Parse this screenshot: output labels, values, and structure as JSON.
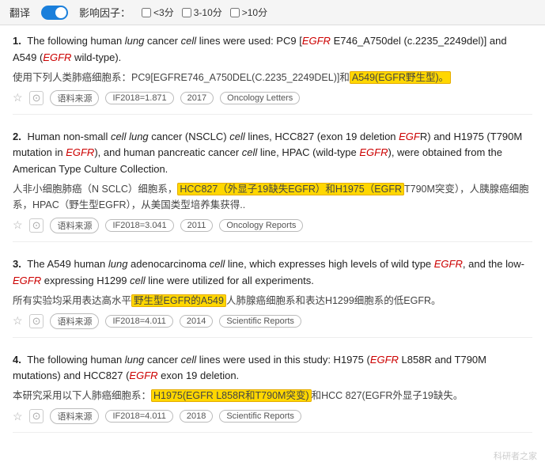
{
  "header": {
    "translate_label": "翻译",
    "toggle_state": true,
    "filter_label": "影响因子：",
    "filters": [
      {
        "label": "<3分",
        "checked": false
      },
      {
        "label": "3-10分",
        "checked": false
      },
      {
        "label": ">10分",
        "checked": false
      }
    ]
  },
  "results": [
    {
      "number": "1.",
      "en_text_parts": [
        {
          "text": "The following human ",
          "style": "normal"
        },
        {
          "text": "lung",
          "style": "italic"
        },
        {
          "text": " cancer ",
          "style": "normal"
        },
        {
          "text": "cell",
          "style": "italic"
        },
        {
          "text": " lines were used: PC9 [",
          "style": "normal"
        },
        {
          "text": "EGFR",
          "style": "italic-red"
        },
        {
          "text": " E746_A750del (c.2235_2249del)] and A549 (",
          "style": "normal"
        },
        {
          "text": "EGFR",
          "style": "italic-red"
        },
        {
          "text": " wild-type).",
          "style": "normal"
        }
      ],
      "cn_parts": [
        {
          "text": "使用下列人类肺癌细胞系：PC9[EGFRE746_A750DEL(C.2235_2249DEL)]和",
          "style": "normal"
        },
        {
          "text": "A549(EGFR野生型)。",
          "style": "highlight"
        }
      ],
      "meta": {
        "source": "语料来源",
        "if": "IF2018=1.871",
        "year": "2017",
        "journal": "Oncology Letters"
      }
    },
    {
      "number": "2.",
      "en_text_parts": [
        {
          "text": "Human non-small ",
          "style": "normal"
        },
        {
          "text": "cell lung",
          "style": "italic"
        },
        {
          "text": " cancer (NSCLC) ",
          "style": "normal"
        },
        {
          "text": "cell",
          "style": "italic"
        },
        {
          "text": " lines, HCC827 (exon 19 deletion ",
          "style": "normal"
        },
        {
          "text": "EGF",
          "style": "italic-red"
        },
        {
          "text": "R) and H1975 (T790M mutation in ",
          "style": "normal"
        },
        {
          "text": "EGFR",
          "style": "italic-red"
        },
        {
          "text": "), and human pancreatic cancer ",
          "style": "normal"
        },
        {
          "text": "cell",
          "style": "italic"
        },
        {
          "text": " line, HPAC (wild-type ",
          "style": "normal"
        },
        {
          "text": "EGFR",
          "style": "italic-red"
        },
        {
          "text": "), were obtained from the American Type Culture Collection.",
          "style": "normal"
        }
      ],
      "cn_parts": [
        {
          "text": "人非小细胞肺癌（N SCLC）细胞系，",
          "style": "normal"
        },
        {
          "text": "HCC827（外显子19缺失EGFR）和H1975（EGFR",
          "style": "highlight"
        },
        {
          "text": "T790M突变），人胰腺癌细胞系，HPAC（野生型EGFR），从美国类型培养集获得..",
          "style": "normal"
        }
      ],
      "meta": {
        "source": "语料来源",
        "if": "IF2018=3.041",
        "year": "2011",
        "journal": "Oncology Reports"
      }
    },
    {
      "number": "3.",
      "en_text_parts": [
        {
          "text": "The A549 human ",
          "style": "normal"
        },
        {
          "text": "lung",
          "style": "italic"
        },
        {
          "text": " adenocarcinoma ",
          "style": "normal"
        },
        {
          "text": "cell",
          "style": "italic"
        },
        {
          "text": " line, which expresses high levels of wild type ",
          "style": "normal"
        },
        {
          "text": "EGFR",
          "style": "italic-red"
        },
        {
          "text": ", and the low-",
          "style": "normal"
        },
        {
          "text": "EGFR",
          "style": "italic-red"
        },
        {
          "text": " expressing H1299 ",
          "style": "normal"
        },
        {
          "text": "cell",
          "style": "italic"
        },
        {
          "text": " line were utilized for all experiments.",
          "style": "normal"
        }
      ],
      "cn_parts": [
        {
          "text": "所有实验均采用表达高水平",
          "style": "normal"
        },
        {
          "text": "野生型EGFR的A549",
          "style": "highlight"
        },
        {
          "text": "人肺腺癌细胞系和表达H1299细胞系的低EGFR。",
          "style": "normal"
        }
      ],
      "meta": {
        "source": "语料来源",
        "if": "IF2018=4.011",
        "year": "2014",
        "journal": "Scientific Reports"
      }
    },
    {
      "number": "4.",
      "en_text_parts": [
        {
          "text": "The following human ",
          "style": "normal"
        },
        {
          "text": "lung",
          "style": "italic"
        },
        {
          "text": " cancer ",
          "style": "normal"
        },
        {
          "text": "cell",
          "style": "italic"
        },
        {
          "text": " lines were used in this study: H1975 (",
          "style": "normal"
        },
        {
          "text": "EGFR",
          "style": "italic-red"
        },
        {
          "text": " L858R and T790M mutations) and HCC827 (",
          "style": "normal"
        },
        {
          "text": "EGFR",
          "style": "italic-red"
        },
        {
          "text": " exon 19 deletion.",
          "style": "normal"
        }
      ],
      "cn_parts": [
        {
          "text": "本研究采用以下人肺癌细胞系：",
          "style": "normal"
        },
        {
          "text": "H1975(EGFR L858R和T790M突变)",
          "style": "highlight"
        },
        {
          "text": "和HCC 827(EGFR外显子19缺失。",
          "style": "normal"
        }
      ],
      "meta": {
        "source": "语料来源",
        "if": "IF2018=4.011",
        "year": "2018",
        "journal": "Scientific Reports"
      }
    }
  ],
  "watermark": "科研者之家"
}
